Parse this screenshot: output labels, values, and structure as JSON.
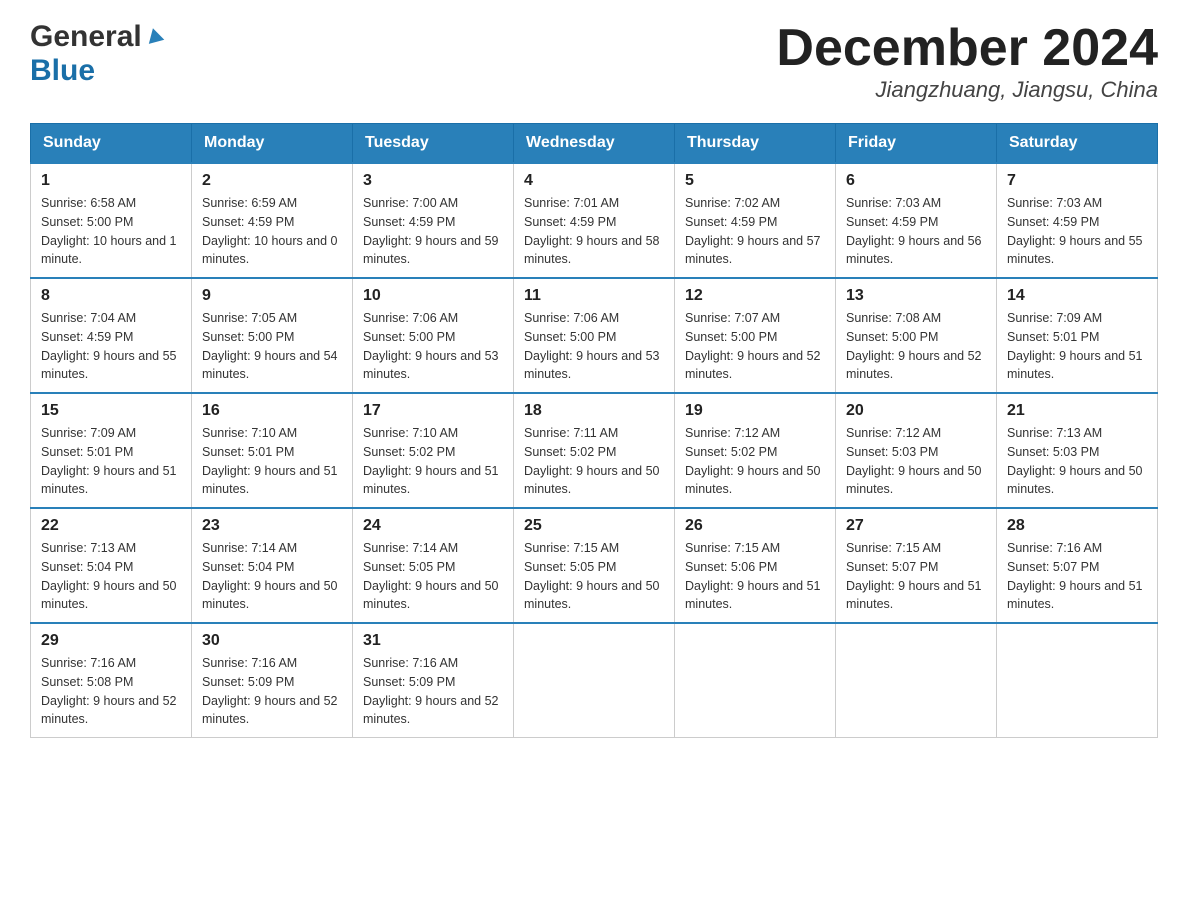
{
  "header": {
    "logo_general": "General",
    "logo_blue": "Blue",
    "month_title": "December 2024",
    "location": "Jiangzhuang, Jiangsu, China"
  },
  "days_of_week": [
    "Sunday",
    "Monday",
    "Tuesday",
    "Wednesday",
    "Thursday",
    "Friday",
    "Saturday"
  ],
  "weeks": [
    [
      {
        "day": "1",
        "sunrise": "6:58 AM",
        "sunset": "5:00 PM",
        "daylight": "10 hours and 1 minute."
      },
      {
        "day": "2",
        "sunrise": "6:59 AM",
        "sunset": "4:59 PM",
        "daylight": "10 hours and 0 minutes."
      },
      {
        "day": "3",
        "sunrise": "7:00 AM",
        "sunset": "4:59 PM",
        "daylight": "9 hours and 59 minutes."
      },
      {
        "day": "4",
        "sunrise": "7:01 AM",
        "sunset": "4:59 PM",
        "daylight": "9 hours and 58 minutes."
      },
      {
        "day": "5",
        "sunrise": "7:02 AM",
        "sunset": "4:59 PM",
        "daylight": "9 hours and 57 minutes."
      },
      {
        "day": "6",
        "sunrise": "7:03 AM",
        "sunset": "4:59 PM",
        "daylight": "9 hours and 56 minutes."
      },
      {
        "day": "7",
        "sunrise": "7:03 AM",
        "sunset": "4:59 PM",
        "daylight": "9 hours and 55 minutes."
      }
    ],
    [
      {
        "day": "8",
        "sunrise": "7:04 AM",
        "sunset": "4:59 PM",
        "daylight": "9 hours and 55 minutes."
      },
      {
        "day": "9",
        "sunrise": "7:05 AM",
        "sunset": "5:00 PM",
        "daylight": "9 hours and 54 minutes."
      },
      {
        "day": "10",
        "sunrise": "7:06 AM",
        "sunset": "5:00 PM",
        "daylight": "9 hours and 53 minutes."
      },
      {
        "day": "11",
        "sunrise": "7:06 AM",
        "sunset": "5:00 PM",
        "daylight": "9 hours and 53 minutes."
      },
      {
        "day": "12",
        "sunrise": "7:07 AM",
        "sunset": "5:00 PM",
        "daylight": "9 hours and 52 minutes."
      },
      {
        "day": "13",
        "sunrise": "7:08 AM",
        "sunset": "5:00 PM",
        "daylight": "9 hours and 52 minutes."
      },
      {
        "day": "14",
        "sunrise": "7:09 AM",
        "sunset": "5:01 PM",
        "daylight": "9 hours and 51 minutes."
      }
    ],
    [
      {
        "day": "15",
        "sunrise": "7:09 AM",
        "sunset": "5:01 PM",
        "daylight": "9 hours and 51 minutes."
      },
      {
        "day": "16",
        "sunrise": "7:10 AM",
        "sunset": "5:01 PM",
        "daylight": "9 hours and 51 minutes."
      },
      {
        "day": "17",
        "sunrise": "7:10 AM",
        "sunset": "5:02 PM",
        "daylight": "9 hours and 51 minutes."
      },
      {
        "day": "18",
        "sunrise": "7:11 AM",
        "sunset": "5:02 PM",
        "daylight": "9 hours and 50 minutes."
      },
      {
        "day": "19",
        "sunrise": "7:12 AM",
        "sunset": "5:02 PM",
        "daylight": "9 hours and 50 minutes."
      },
      {
        "day": "20",
        "sunrise": "7:12 AM",
        "sunset": "5:03 PM",
        "daylight": "9 hours and 50 minutes."
      },
      {
        "day": "21",
        "sunrise": "7:13 AM",
        "sunset": "5:03 PM",
        "daylight": "9 hours and 50 minutes."
      }
    ],
    [
      {
        "day": "22",
        "sunrise": "7:13 AM",
        "sunset": "5:04 PM",
        "daylight": "9 hours and 50 minutes."
      },
      {
        "day": "23",
        "sunrise": "7:14 AM",
        "sunset": "5:04 PM",
        "daylight": "9 hours and 50 minutes."
      },
      {
        "day": "24",
        "sunrise": "7:14 AM",
        "sunset": "5:05 PM",
        "daylight": "9 hours and 50 minutes."
      },
      {
        "day": "25",
        "sunrise": "7:15 AM",
        "sunset": "5:05 PM",
        "daylight": "9 hours and 50 minutes."
      },
      {
        "day": "26",
        "sunrise": "7:15 AM",
        "sunset": "5:06 PM",
        "daylight": "9 hours and 51 minutes."
      },
      {
        "day": "27",
        "sunrise": "7:15 AM",
        "sunset": "5:07 PM",
        "daylight": "9 hours and 51 minutes."
      },
      {
        "day": "28",
        "sunrise": "7:16 AM",
        "sunset": "5:07 PM",
        "daylight": "9 hours and 51 minutes."
      }
    ],
    [
      {
        "day": "29",
        "sunrise": "7:16 AM",
        "sunset": "5:08 PM",
        "daylight": "9 hours and 52 minutes."
      },
      {
        "day": "30",
        "sunrise": "7:16 AM",
        "sunset": "5:09 PM",
        "daylight": "9 hours and 52 minutes."
      },
      {
        "day": "31",
        "sunrise": "7:16 AM",
        "sunset": "5:09 PM",
        "daylight": "9 hours and 52 minutes."
      },
      null,
      null,
      null,
      null
    ]
  ],
  "labels": {
    "sunrise_prefix": "Sunrise: ",
    "sunset_prefix": "Sunset: ",
    "daylight_prefix": "Daylight: "
  }
}
